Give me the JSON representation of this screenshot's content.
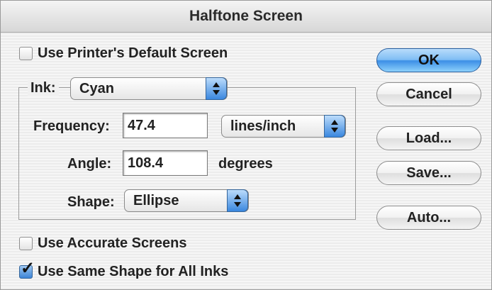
{
  "title": "Halftone Screen",
  "checkboxes": {
    "printer_default": {
      "label": "Use Printer's Default Screen",
      "checked": false
    },
    "accurate": {
      "label": "Use Accurate Screens",
      "checked": false
    },
    "same_shape": {
      "label": "Use Same Shape for All Inks",
      "checked": true
    }
  },
  "ink": {
    "label": "Ink:",
    "value": "Cyan"
  },
  "frequency": {
    "label": "Frequency:",
    "value": "47.4",
    "unit": "lines/inch"
  },
  "angle": {
    "label": "Angle:",
    "value": "108.4",
    "unit": "degrees"
  },
  "shape": {
    "label": "Shape:",
    "value": "Ellipse"
  },
  "buttons": {
    "ok": "OK",
    "cancel": "Cancel",
    "load": "Load...",
    "save": "Save...",
    "auto": "Auto..."
  },
  "colors": {
    "default_button": "#3b8ee6",
    "popup_arrow": "#3a87df"
  }
}
